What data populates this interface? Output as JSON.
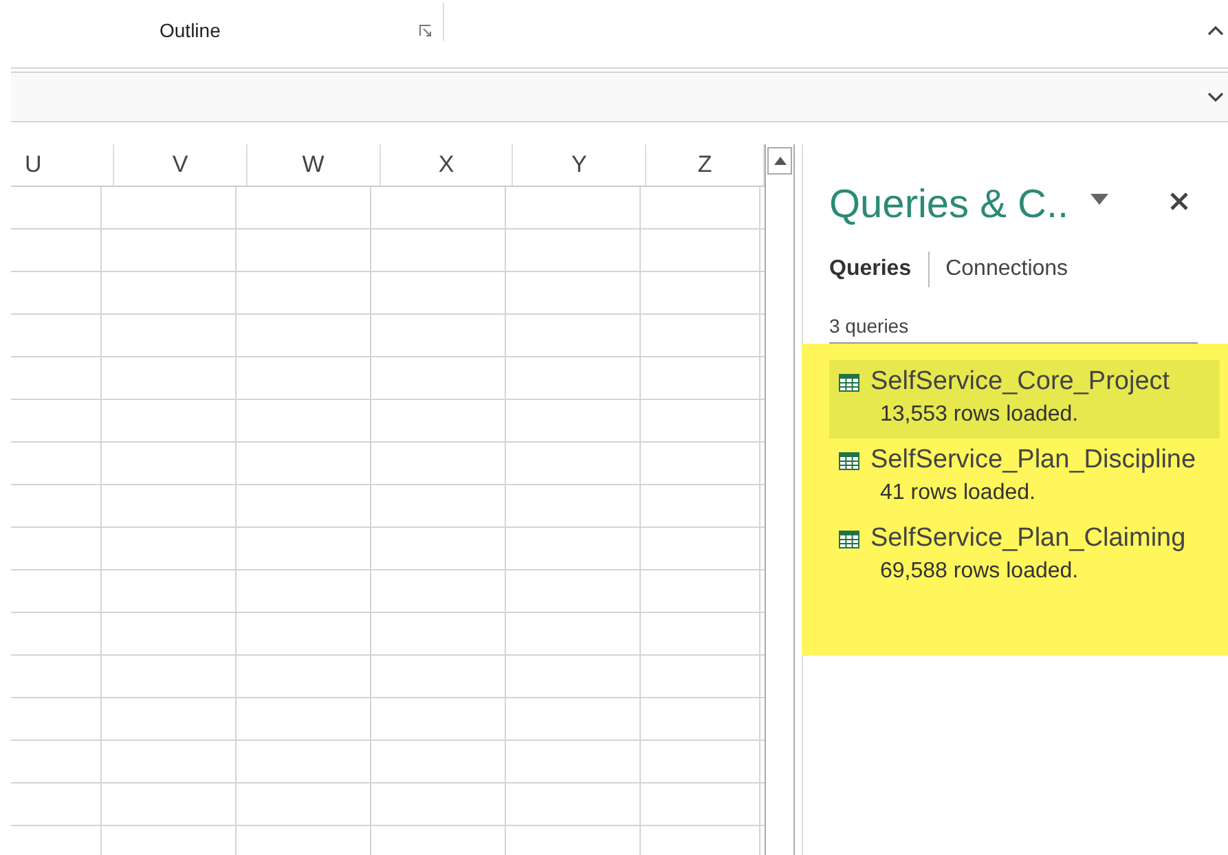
{
  "ribbon": {
    "group_label": "Outline"
  },
  "columns": [
    "U",
    "V",
    "W",
    "X",
    "Y",
    "Z"
  ],
  "pane": {
    "title": "Queries & C..",
    "tabs": [
      {
        "label": "Queries",
        "selected": true
      },
      {
        "label": "Connections",
        "selected": false
      }
    ],
    "count": "3 queries",
    "queries": [
      {
        "name": "SelfService_Core_Project",
        "status": "13,553 rows loaded.",
        "selected": true
      },
      {
        "name": "SelfService_Plan_Discipline",
        "status": "41 rows loaded.",
        "selected": false
      },
      {
        "name": "SelfService_Plan_Claiming",
        "status": "69,588 rows loaded.",
        "selected": false
      }
    ]
  }
}
